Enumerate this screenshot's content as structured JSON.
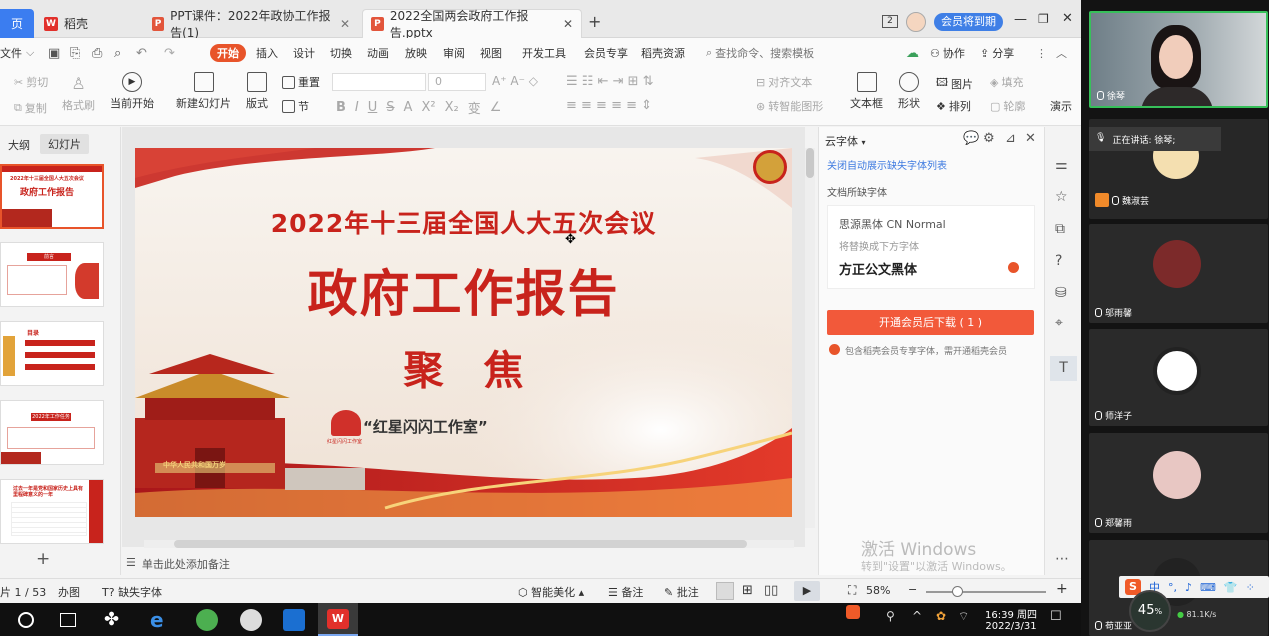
{
  "titlebar": {
    "home_tab": "页",
    "tabs": [
      {
        "icon": "daoke-icon",
        "label": "稻壳"
      },
      {
        "icon": "ppt-file-icon",
        "label": "PPT课件：2022年政协工作报告(1)"
      },
      {
        "icon": "ppt-file-icon",
        "label": "2022全国两会政府工作报告.pptx"
      }
    ],
    "badge_number": "2",
    "member_label": "会员将到期"
  },
  "menu": {
    "file": "文件",
    "items": [
      "开始",
      "插入",
      "设计",
      "切换",
      "动画",
      "放映",
      "审阅",
      "视图",
      "开发工具",
      "会员专享",
      "稻壳资源"
    ],
    "search_placeholder": "查找命令、搜索模板",
    "collab": "协作",
    "share": "分享"
  },
  "ribbon": {
    "cut": "剪切",
    "copy": "复制",
    "format_painter": "格式刷",
    "start_from_current": "当前开始",
    "new_slide": "新建幻灯片",
    "layout": "版式",
    "section": "节",
    "reset": "重置",
    "font_size": "0",
    "align_text": "对齐文本",
    "smart_shape": "转智能图形",
    "textbox": "文本框",
    "shape": "形状",
    "picture": "图片",
    "fill": "填充",
    "arrange": "排列",
    "outline": "轮廓",
    "present": "演示"
  },
  "left_panel": {
    "outline_tab": "大纲",
    "slides_tab": "幻灯片",
    "add": "+",
    "thumbnails": [
      {
        "title": "2022年十三届全国人大五次会议",
        "subtitle": "政府工作报告"
      },
      {
        "title": "前言"
      },
      {
        "title": "目录"
      },
      {
        "title": "2022年工作任务"
      },
      {
        "title": "过去一年是党和国家历史上具有里程碑意义的一年"
      }
    ]
  },
  "slide": {
    "title": "2022年十三届全国人大五次会议",
    "main": "政府工作报告",
    "focus": "聚　焦",
    "brand": "“红星闪闪工作室”",
    "brand_small": "红星闪闪工作室",
    "gate_sign": "中华人民共和国万岁"
  },
  "notes_placeholder": "单击此处添加备注",
  "cloud_font": {
    "header": "云字体",
    "close_list": "关闭自动展示缺失字体列表",
    "missing_label": "文档所缺字体",
    "missing_font": "思源黑体 CN Normal",
    "replace_label": "将替换成下方字体",
    "replacement": "方正公文黑体",
    "download_button": "开通会员后下载 ( 1 )",
    "note": "包含稻壳会员专享字体，需开通稻壳会员"
  },
  "watermark": {
    "line1": "激活 Windows",
    "line2": "转到\"设置\"以激活 Windows。"
  },
  "statusbar": {
    "page": "片 1 / 53",
    "office": "办图",
    "missing_font": "缺失字体",
    "beautify": "智能美化",
    "notes": "备注",
    "comment": "批注",
    "zoom": "58%"
  },
  "taskbar": {
    "time": "16:39 周四",
    "date": "2022/3/31"
  },
  "meeting": {
    "speaker": "徐琴",
    "speaking_now": "正在讲话: 徐琴;",
    "participants": [
      "魏淑芸",
      "邬雨馨",
      "师洋子",
      "郑馨雨",
      "苟亚亚"
    ],
    "cpu": "45",
    "cpu_unit": "%",
    "net_speed": "81.1",
    "net_unit": "K/s",
    "ime": "中"
  },
  "colors": {
    "accent": "#e8542a",
    "slide_red": "#c8231c",
    "link_blue": "#3d7ae0"
  }
}
